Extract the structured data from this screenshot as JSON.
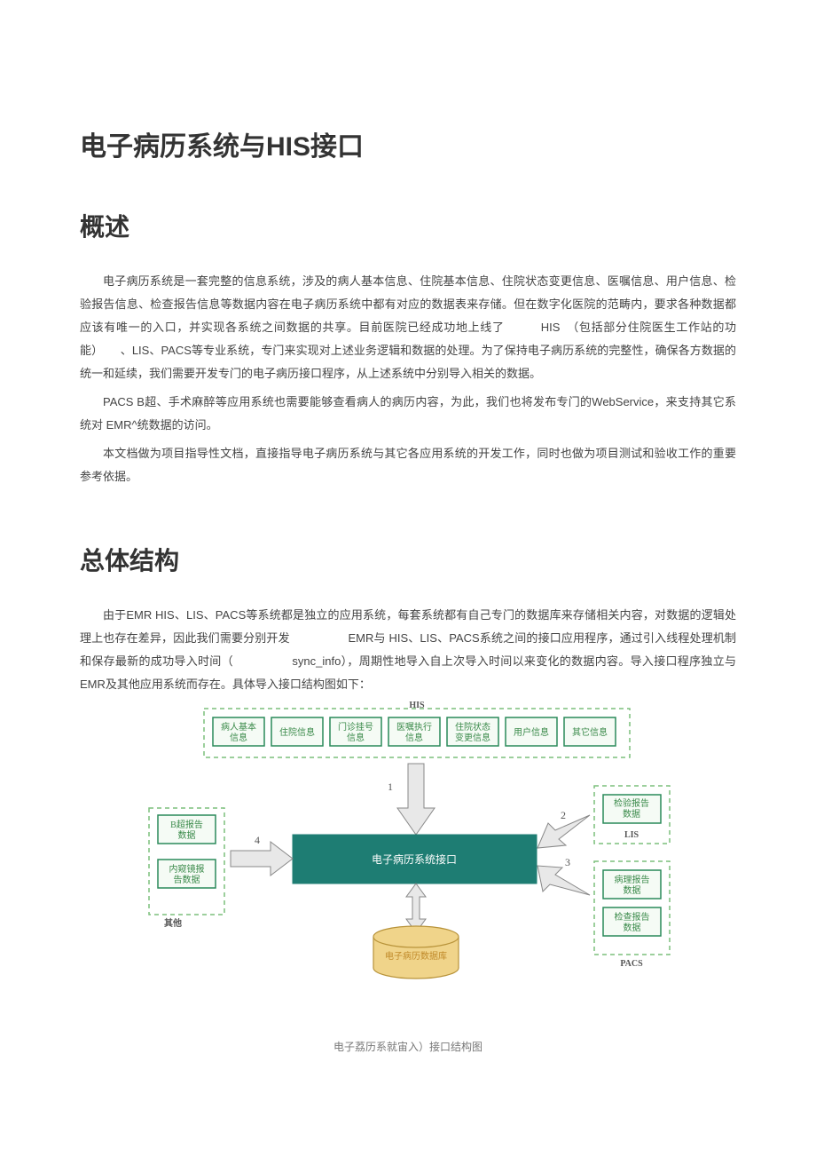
{
  "title": "电子病历系统与HIS接口",
  "sections": {
    "overview": {
      "heading": "概述",
      "p1": "电子病历系统是一套完整的信息系统，涉及的病人基本信息、住院基本信息、住院状态变更信息、医嘱信息、用户信息、检验报告信息、检查报告信息等数据内容在电子病历系统中都有对应的数据表来存储。但在数字化医院的范畴内，要求各种数据都应该有唯一的入口，并实现各系统之间数据的共享。目前医院已经成功地上线了　　　HIS　（包括部分住院医生工作站的功能）　　、LIS、PACS等专业系统，专门来实现对上述业务逻辑和数据的处理。为了保持电子病历系统的完整性，确保各方数据的统一和延续，我们需要开发专门的电子病历接口程序，从上述系统中分别导入相关的数据。",
      "p2": "PACS B超、手术麻醉等应用系统也需要能够查看病人的病历内容，为此，我们也将发布专门的WebService，来支持其它系统对 EMR^统数据的访问。",
      "p3": "本文档做为项目指导性文档，直接指导电子病历系统与其它各应用系统的开发工作，同时也做为项目测试和验收工作的重要参考依据。"
    },
    "structure": {
      "heading": "总体结构",
      "p1": "由于EMR HIS、LIS、PACS等系统都是独立的应用系统，每套系统都有自己专门的数据库来存储相关内容，对数据的逻辑处理上也存在差异，因此我们需要分别开发　　　　　EMR与 HIS、LIS、PACS系统之间的接口应用程序，通过引入线程处理机制和保存最新的成功导入时间（　　　　　sync_info），周期性地导入自上次导入时间以来变化的数据内容。导入接口程序独立与　　　　　EMR及其他应用系统而存在。具体导入接口结构图如下："
    }
  },
  "diagram": {
    "his_label": "HIS",
    "his_boxes": [
      "病人基本\n信息",
      "住院信息",
      "门诊挂号\n信息",
      "医嘱执行\n信息",
      "住院状态\n变更信息",
      "用户信息",
      "其它信息"
    ],
    "left_boxes": [
      "B超报告\n数据",
      "内窥镜报\n告数据"
    ],
    "left_label": "其他",
    "lis_box": "检验报告\n数据",
    "lis_label": "LIS",
    "pacs_boxes": [
      "病理报告\n数据",
      "检查报告\n数据"
    ],
    "pacs_label": "PACS",
    "center": "电子病历系统接口",
    "db": "电子病历数据库",
    "arrows": [
      "1",
      "2",
      "3",
      "4"
    ]
  },
  "caption": "电子荔历系就宙入）接口结构图"
}
